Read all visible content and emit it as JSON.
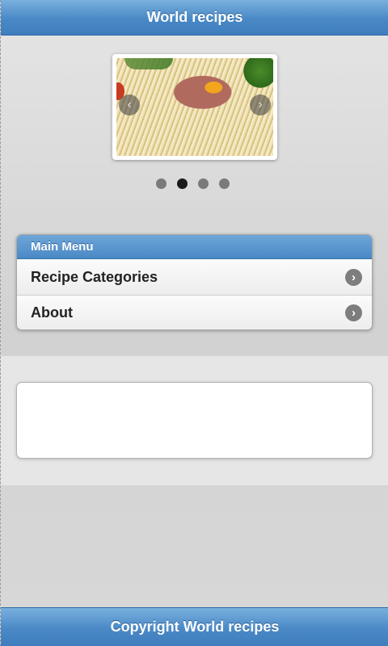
{
  "header": {
    "title": "World recipes"
  },
  "slider": {
    "image": "pasta-carbonara-photo",
    "prev_icon": "chevron-left-icon",
    "next_icon": "chevron-right-icon",
    "dots": 4,
    "active_index": 1
  },
  "menu": {
    "title": "Main Menu",
    "items": [
      {
        "label": "Recipe Categories",
        "icon": "chevron-right-icon"
      },
      {
        "label": "About",
        "icon": "chevron-right-icon"
      }
    ]
  },
  "footer": {
    "text": "Copyright World recipes"
  },
  "colors": {
    "accent": "#4a89c6",
    "background": "#dedede",
    "dot_active": "#1a1a1a",
    "dot_inactive": "#7a7a7a"
  }
}
